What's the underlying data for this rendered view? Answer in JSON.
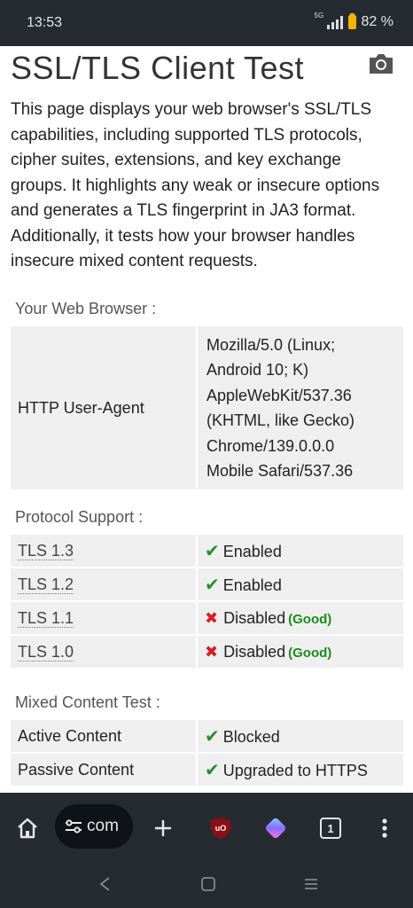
{
  "status": {
    "time": "13:53",
    "network": "5G",
    "battery": "82 %"
  },
  "page": {
    "title": "SSL/TLS Client Test",
    "intro": "This page displays your web browser's SSL/TLS capabilities, including supported TLS protocols, cipher suites, extensions, and key exchange groups. It highlights any weak or insecure options and generates a TLS fingerprint in JA3 format. Additionally, it tests how your browser handles insecure mixed content requests."
  },
  "browser_section": {
    "heading": "Your Web Browser :",
    "ua_label": "HTTP User-Agent",
    "ua_lines": [
      "Mozilla/5.0 (Linux;",
      "Android 10; K)",
      "AppleWebKit/537.36",
      "(KHTML, like Gecko)",
      "Chrome/139.0.0.0",
      "Mobile Safari/537.36"
    ]
  },
  "protocol_section": {
    "heading": "Protocol Support :",
    "rows": [
      {
        "name": "TLS 1.3",
        "status": "Enabled",
        "icon": "check-icon",
        "note": ""
      },
      {
        "name": "TLS 1.2",
        "status": "Enabled",
        "icon": "check-icon",
        "note": ""
      },
      {
        "name": "TLS 1.1",
        "status": "Disabled",
        "icon": "cross-icon",
        "note": "(Good)"
      },
      {
        "name": "TLS 1.0",
        "status": "Disabled",
        "icon": "cross-icon",
        "note": "(Good)"
      }
    ]
  },
  "mixed_section": {
    "heading": "Mixed Content Test :",
    "rows": [
      {
        "name": "Active Content",
        "status": "Blocked",
        "icon": "check-icon"
      },
      {
        "name": "Passive Content",
        "status": "Upgraded to HTTPS",
        "icon": "check-icon"
      }
    ]
  },
  "toolbar": {
    "url_text": "com",
    "tab_count": "1",
    "extension_label": "uO"
  },
  "colors": {
    "bars": "#262b31",
    "cell": "#efefef",
    "check": "#2e8b2e",
    "cross": "#d61f1f",
    "good": "#1a8f1a"
  }
}
